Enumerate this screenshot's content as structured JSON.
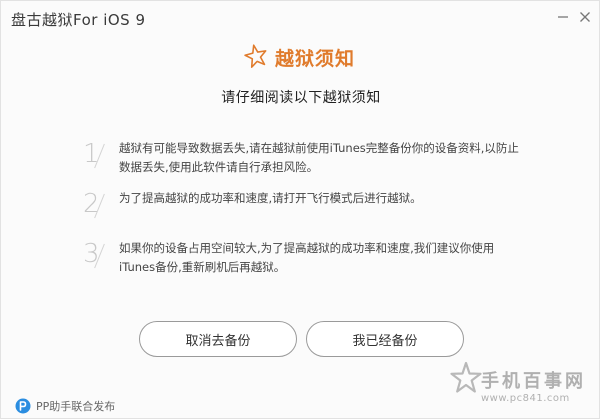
{
  "window": {
    "title": "盘古越狱For iOS 9",
    "minimize_glyph": "—",
    "close_glyph": "✕"
  },
  "header": {
    "title": "越狱须知",
    "subtitle": "请仔细阅读以下越狱须知",
    "accent_color": "#e07b2c"
  },
  "notices": [
    {
      "number": "1",
      "text": "越狱有可能导致数据丢失,请在越狱前使用iTunes完整备份你的设备资料,以防止数据丢失,使用此软件请自行承担风险。"
    },
    {
      "number": "2",
      "text": "为了提高越狱的成功率和速度,请打开飞行模式后进行越狱。"
    },
    {
      "number": "3",
      "text": "如果你的设备占用空间较大,为了提高越狱的成功率和速度,我们建议你使用iTunes备份,重新刷机后再越狱。"
    }
  ],
  "buttons": {
    "cancel_label": "取消去备份",
    "confirm_label": "我已经备份"
  },
  "footer": {
    "text": "PP助手联合发布",
    "icon": "pp-icon"
  },
  "watermark": {
    "title": "手机百事网",
    "url": "www.pc841.com"
  }
}
